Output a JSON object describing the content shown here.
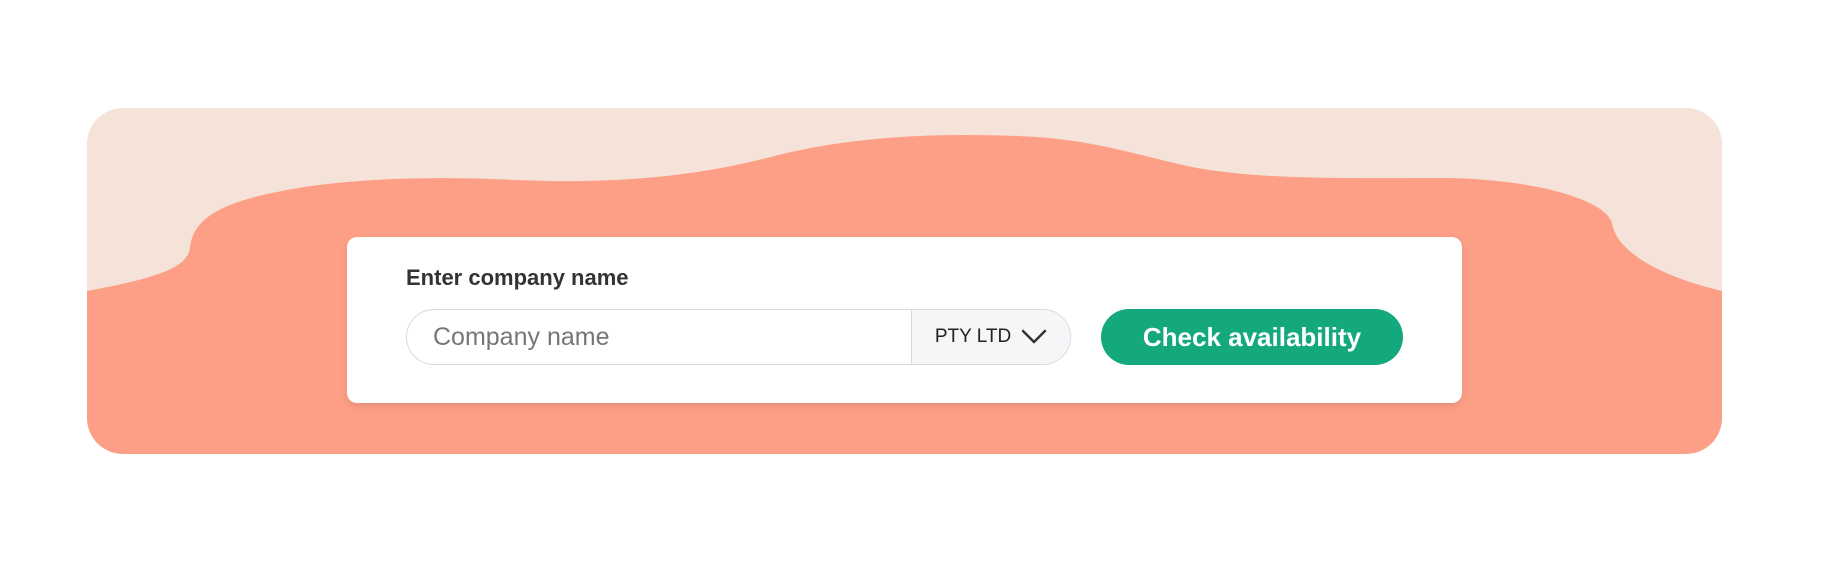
{
  "form": {
    "label": "Enter company name",
    "input_value": "",
    "input_placeholder": "Company name",
    "suffix_selected": "PTY LTD",
    "button_label": "Check availability"
  },
  "icons": {
    "dropdown": "chevron-down-icon"
  },
  "colors": {
    "background_light": "#f5e2d9",
    "background_accent": "#fd9f86",
    "button": "#14a97c",
    "button_text": "#ffffff",
    "card": "#ffffff"
  }
}
